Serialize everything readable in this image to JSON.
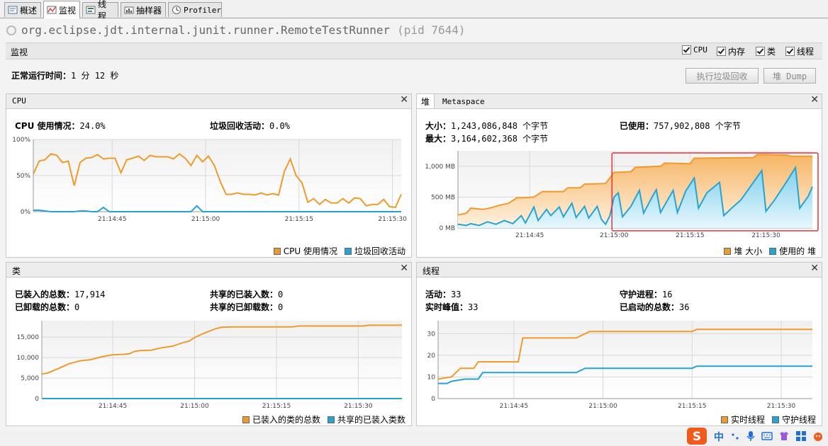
{
  "tabs": [
    {
      "label": "概述",
      "icon": "overview-icon"
    },
    {
      "label": "监视",
      "icon": "monitor-icon"
    },
    {
      "label": "线程",
      "icon": "threads-icon"
    },
    {
      "label": "抽样器",
      "icon": "sampler-icon"
    },
    {
      "label": "Profiler",
      "icon": "profiler-icon"
    }
  ],
  "process": {
    "name": "org.eclipse.jdt.internal.junit.runner.RemoteTestRunner",
    "pid": "(pid 7644)"
  },
  "monitor_bar": {
    "label": "监视",
    "checkboxes": [
      {
        "label": "CPU",
        "checked": true
      },
      {
        "label": "内存",
        "checked": true
      },
      {
        "label": "类",
        "checked": true
      },
      {
        "label": "线程",
        "checked": true
      }
    ]
  },
  "uptime": {
    "label": "正常运行时间：",
    "value": "1 分 12 秒"
  },
  "buttons": {
    "gc": "执行垃圾回收",
    "heap_dump": "堆 Dump"
  },
  "colors": {
    "orange": "#ef9b2c",
    "blue": "#27a3d3",
    "highlight": "#e8303a"
  },
  "cpu_panel": {
    "title": "CPU",
    "usage_label": "CPU 使用情况：",
    "usage_value": "24.0%",
    "gc_label": "垃圾回收活动：",
    "gc_value": "0.0%",
    "legend": [
      "CPU 使用情况",
      "垃圾回收活动"
    ]
  },
  "heap_panel": {
    "tabs": [
      "堆",
      "Metaspace"
    ],
    "size_label": "大小：",
    "size_value": "1,243,086,848 个字节",
    "max_label": "最大：",
    "max_value": "3,164,602,368 个字节",
    "used_label": "已使用：",
    "used_value": "757,902,808 个字节",
    "legend": [
      "堆 大小",
      "使用的 堆"
    ]
  },
  "classes_panel": {
    "title": "类",
    "loaded_label": "已装入的总数：",
    "loaded_value": "17,914",
    "unloaded_label": "已卸载的总数：",
    "unloaded_value": "0",
    "shared_loaded_label": "共享的已装入数：",
    "shared_loaded_value": "0",
    "shared_unloaded_label": "共享的已卸载数：",
    "shared_unloaded_value": "0",
    "legend": [
      "已装入的类的总数",
      "共享的已装入类数"
    ]
  },
  "threads_panel": {
    "title": "线程",
    "live_label": "活动：",
    "live_value": "33",
    "peak_label": "实时峰值：",
    "peak_value": "33",
    "daemon_label": "守护进程：",
    "daemon_value": "16",
    "started_label": "已启动的总数：",
    "started_value": "36",
    "legend": [
      "实时线程",
      "守护线程"
    ]
  },
  "chart_data": [
    {
      "type": "line",
      "title": "CPU",
      "x_ticks": [
        "21:14:45",
        "21:15:00",
        "21:15:15",
        "21:15:30"
      ],
      "y_ticks": [
        "0%",
        "50%",
        "100%"
      ],
      "ylim": [
        0,
        100
      ],
      "x": [
        0,
        1,
        2,
        3,
        4,
        5,
        6,
        7,
        8,
        9,
        10,
        11,
        12,
        13,
        14,
        15,
        16,
        17,
        18,
        19,
        20,
        21,
        22,
        23,
        24,
        25,
        26,
        27,
        28,
        29,
        30,
        31,
        32,
        33,
        34,
        35,
        36,
        37,
        38,
        39,
        40,
        41,
        42,
        43,
        44,
        45,
        46,
        47,
        48,
        49,
        50,
        51,
        52,
        53,
        54,
        55,
        56,
        57,
        58,
        59,
        60,
        61,
        62,
        63
      ],
      "series": [
        {
          "name": "CPU 使用情况",
          "values": [
            52,
            70,
            72,
            80,
            78,
            68,
            70,
            36,
            68,
            74,
            75,
            79,
            73,
            74,
            74,
            54,
            72,
            74,
            77,
            71,
            78,
            76,
            76,
            76,
            73,
            80,
            74,
            64,
            78,
            69,
            77,
            64,
            42,
            24,
            24,
            26,
            24,
            24,
            23,
            26,
            23,
            25,
            23,
            56,
            73,
            50,
            40,
            13,
            18,
            10,
            17,
            12,
            12,
            18,
            12,
            19,
            18,
            8,
            10,
            10,
            17,
            7,
            6,
            24
          ]
        },
        {
          "name": "垃圾回收活动",
          "values": [
            2,
            2,
            1,
            0,
            0,
            0,
            0,
            0,
            1,
            1,
            0,
            0,
            6,
            0,
            0,
            0,
            0,
            0,
            0,
            0,
            0,
            0,
            0,
            0,
            0,
            0,
            0,
            0,
            8,
            0,
            0,
            0,
            0,
            0,
            0,
            0,
            0,
            0,
            0,
            0,
            0,
            0,
            0,
            0,
            0,
            0,
            0,
            0,
            0,
            0,
            0,
            0,
            0,
            0,
            0,
            0,
            0,
            0,
            0,
            0,
            0,
            0,
            0,
            0
          ]
        }
      ]
    },
    {
      "type": "area",
      "title": "堆",
      "x_ticks": [
        "21:14:45",
        "21:15:00",
        "21:15:15",
        "21:15:30"
      ],
      "y_ticks": [
        "0 MB",
        "500 MB",
        "1,000 MB"
      ],
      "ylim": [
        0,
        1250
      ],
      "series": [
        {
          "name": "堆 大小",
          "points": [
            [
              0,
              210
            ],
            [
              2,
              240
            ],
            [
              3,
              320
            ],
            [
              6,
              300
            ],
            [
              8,
              330
            ],
            [
              10,
              370
            ],
            [
              12,
              400
            ],
            [
              14,
              490
            ],
            [
              16,
              490
            ],
            [
              18,
              500
            ],
            [
              20,
              590
            ],
            [
              25,
              590
            ],
            [
              26,
              650
            ],
            [
              29,
              650
            ],
            [
              30,
              710
            ],
            [
              35,
              720
            ],
            [
              37,
              900
            ],
            [
              41,
              910
            ],
            [
              42,
              980
            ],
            [
              48,
              1000
            ],
            [
              49,
              1050
            ],
            [
              55,
              1040
            ],
            [
              56,
              1130
            ],
            [
              70,
              1140
            ],
            [
              71,
              1190
            ],
            [
              78,
              1180
            ],
            [
              79,
              1160
            ],
            [
              84,
              1160
            ]
          ]
        },
        {
          "name": "使用的 堆",
          "points": [
            [
              0,
              60
            ],
            [
              2,
              40
            ],
            [
              3,
              70
            ],
            [
              5,
              40
            ],
            [
              7,
              100
            ],
            [
              9,
              60
            ],
            [
              11,
              120
            ],
            [
              13,
              70
            ],
            [
              15,
              200
            ],
            [
              16,
              80
            ],
            [
              18,
              340
            ],
            [
              19,
              120
            ],
            [
              21,
              300
            ],
            [
              22,
              200
            ],
            [
              24,
              340
            ],
            [
              25,
              180
            ],
            [
              27,
              400
            ],
            [
              28,
              170
            ],
            [
              30,
              350
            ],
            [
              31,
              160
            ],
            [
              33,
              350
            ],
            [
              34,
              140
            ],
            [
              35,
              60
            ],
            [
              36,
              200
            ],
            [
              37,
              500
            ],
            [
              38,
              570
            ],
            [
              39,
              180
            ],
            [
              41,
              350
            ],
            [
              43,
              610
            ],
            [
              44,
              240
            ],
            [
              46,
              500
            ],
            [
              47,
              620
            ],
            [
              48,
              250
            ],
            [
              50,
              490
            ],
            [
              51,
              610
            ],
            [
              52,
              250
            ],
            [
              54,
              600
            ],
            [
              56,
              810
            ],
            [
              57,
              320
            ],
            [
              59,
              570
            ],
            [
              62,
              740
            ],
            [
              63,
              200
            ],
            [
              65,
              330
            ],
            [
              67,
              450
            ],
            [
              69,
              640
            ],
            [
              72,
              930
            ],
            [
              73,
              270
            ],
            [
              75,
              450
            ],
            [
              78,
              760
            ],
            [
              80,
              980
            ],
            [
              81,
              320
            ],
            [
              83,
              510
            ],
            [
              84,
              670
            ]
          ]
        }
      ]
    },
    {
      "type": "line",
      "title": "类",
      "x_ticks": [
        "21:14:45",
        "21:15:00",
        "21:15:15",
        "21:15:30"
      ],
      "y_ticks": [
        "0",
        "5,000",
        "10,000",
        "15,000"
      ],
      "ylim": [
        0,
        19000
      ],
      "series": [
        {
          "name": "已装入的类的总数",
          "points": [
            [
              0,
              6000
            ],
            [
              1,
              6200
            ],
            [
              3,
              7300
            ],
            [
              5,
              8500
            ],
            [
              7,
              9200
            ],
            [
              9,
              9500
            ],
            [
              11,
              10200
            ],
            [
              13,
              10700
            ],
            [
              15,
              10800
            ],
            [
              16,
              10900
            ],
            [
              17,
              11500
            ],
            [
              18,
              11700
            ],
            [
              20,
              11800
            ],
            [
              22,
              12400
            ],
            [
              24,
              12800
            ],
            [
              26,
              13700
            ],
            [
              27,
              14000
            ],
            [
              28,
              14900
            ],
            [
              30,
              16100
            ],
            [
              32,
              17100
            ],
            [
              33,
              17400
            ],
            [
              35,
              17500
            ],
            [
              40,
              17500
            ],
            [
              46,
              17500
            ],
            [
              47,
              17700
            ],
            [
              59,
              17700
            ],
            [
              60,
              17900
            ],
            [
              66,
              17900
            ]
          ]
        },
        {
          "name": "共享的已装入类数",
          "points": [
            [
              0,
              0
            ],
            [
              66,
              0
            ]
          ]
        }
      ]
    },
    {
      "type": "line",
      "title": "线程",
      "x_ticks": [
        "21:14:45",
        "21:15:00",
        "21:15:15",
        "21:15:30"
      ],
      "y_ticks": [
        "0",
        "10",
        "20",
        "30"
      ],
      "ylim": [
        0,
        36
      ],
      "series": [
        {
          "name": "实时线程",
          "points": [
            [
              0,
              9
            ],
            [
              3,
              10
            ],
            [
              5,
              14
            ],
            [
              8,
              14
            ],
            [
              9,
              17
            ],
            [
              18,
              17
            ],
            [
              19,
              28
            ],
            [
              31,
              28
            ],
            [
              34,
              31
            ],
            [
              57,
              31
            ],
            [
              58,
              32
            ],
            [
              84,
              32
            ]
          ]
        },
        {
          "name": "守护线程",
          "points": [
            [
              0,
              7
            ],
            [
              2,
              7
            ],
            [
              3,
              8
            ],
            [
              6,
              9
            ],
            [
              9,
              9
            ],
            [
              10,
              12
            ],
            [
              31,
              12
            ],
            [
              33,
              14
            ],
            [
              57,
              14
            ],
            [
              58,
              15
            ],
            [
              84,
              15
            ]
          ]
        }
      ]
    }
  ]
}
